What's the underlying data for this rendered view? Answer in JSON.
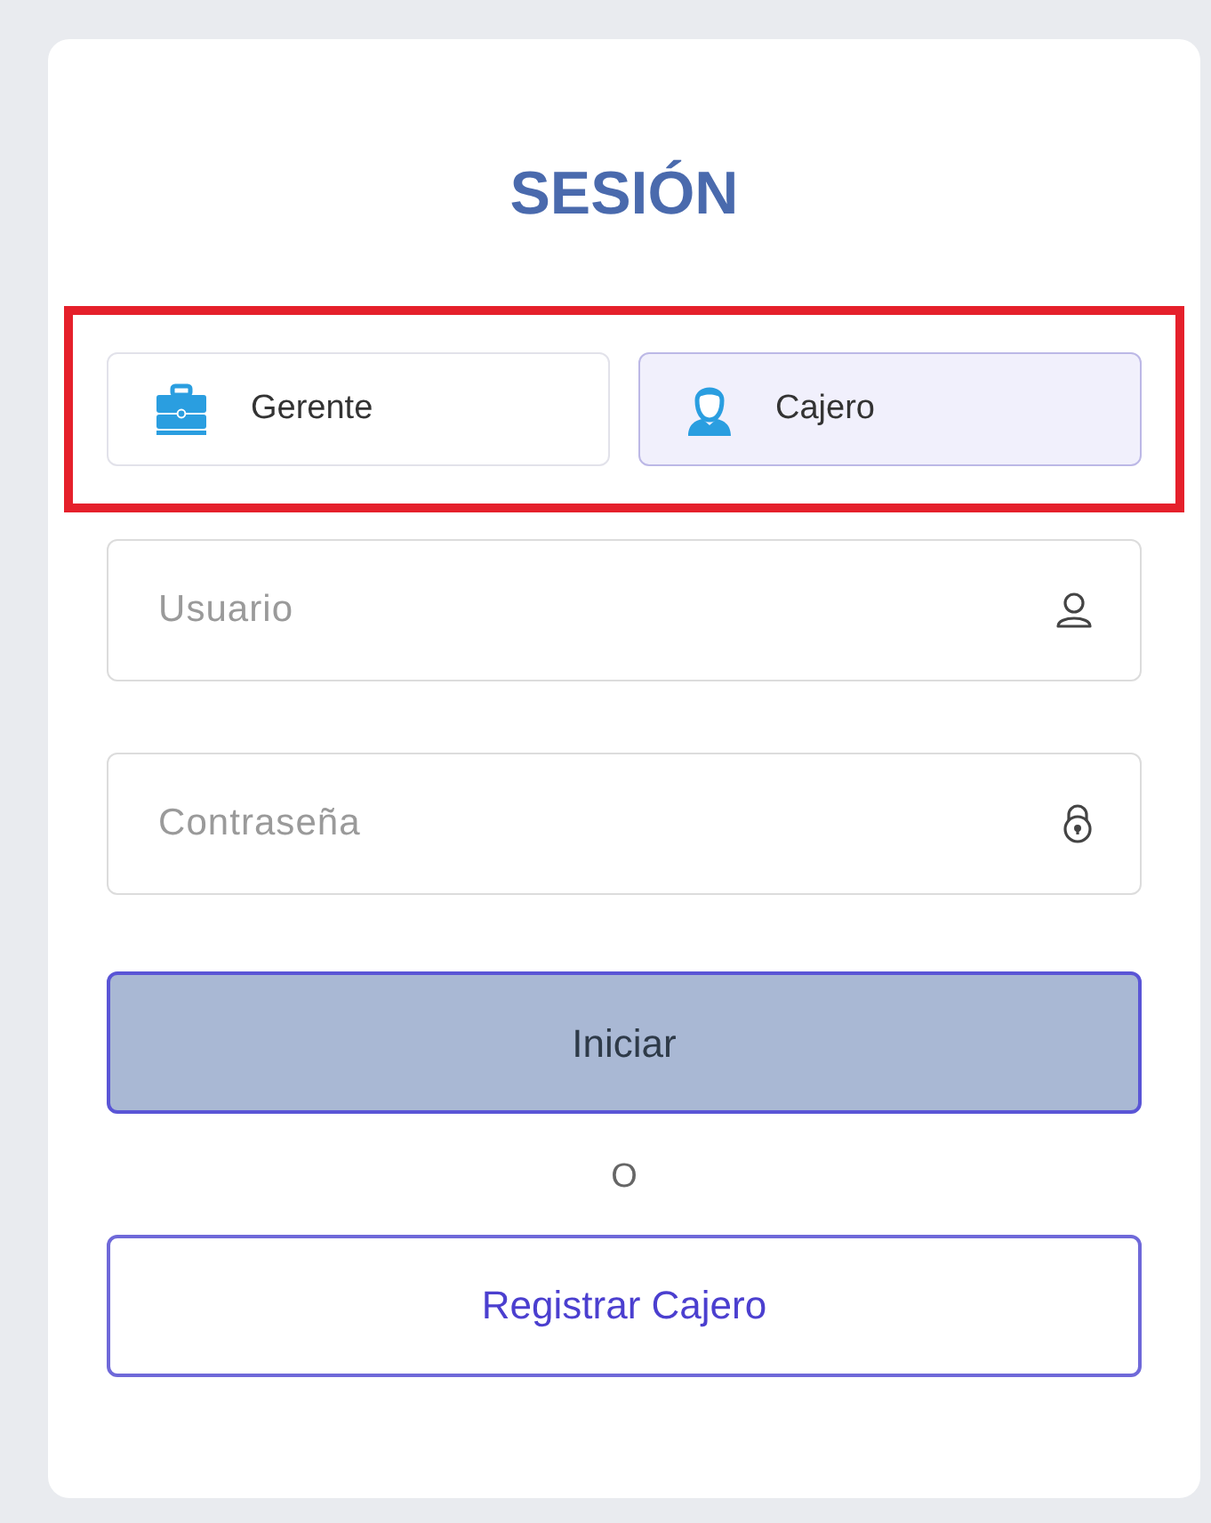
{
  "title": "SESIÓN",
  "roles": [
    {
      "label": "Gerente",
      "kind": "briefcase",
      "selected": false
    },
    {
      "label": "Cajero",
      "kind": "person",
      "selected": true
    }
  ],
  "fields": [
    {
      "placeholder": "Usuario",
      "kind": "user"
    },
    {
      "placeholder": "Contraseña",
      "kind": "lock"
    }
  ],
  "login_button": "Iniciar",
  "separator": "O",
  "register_button": "Registrar Cajero"
}
